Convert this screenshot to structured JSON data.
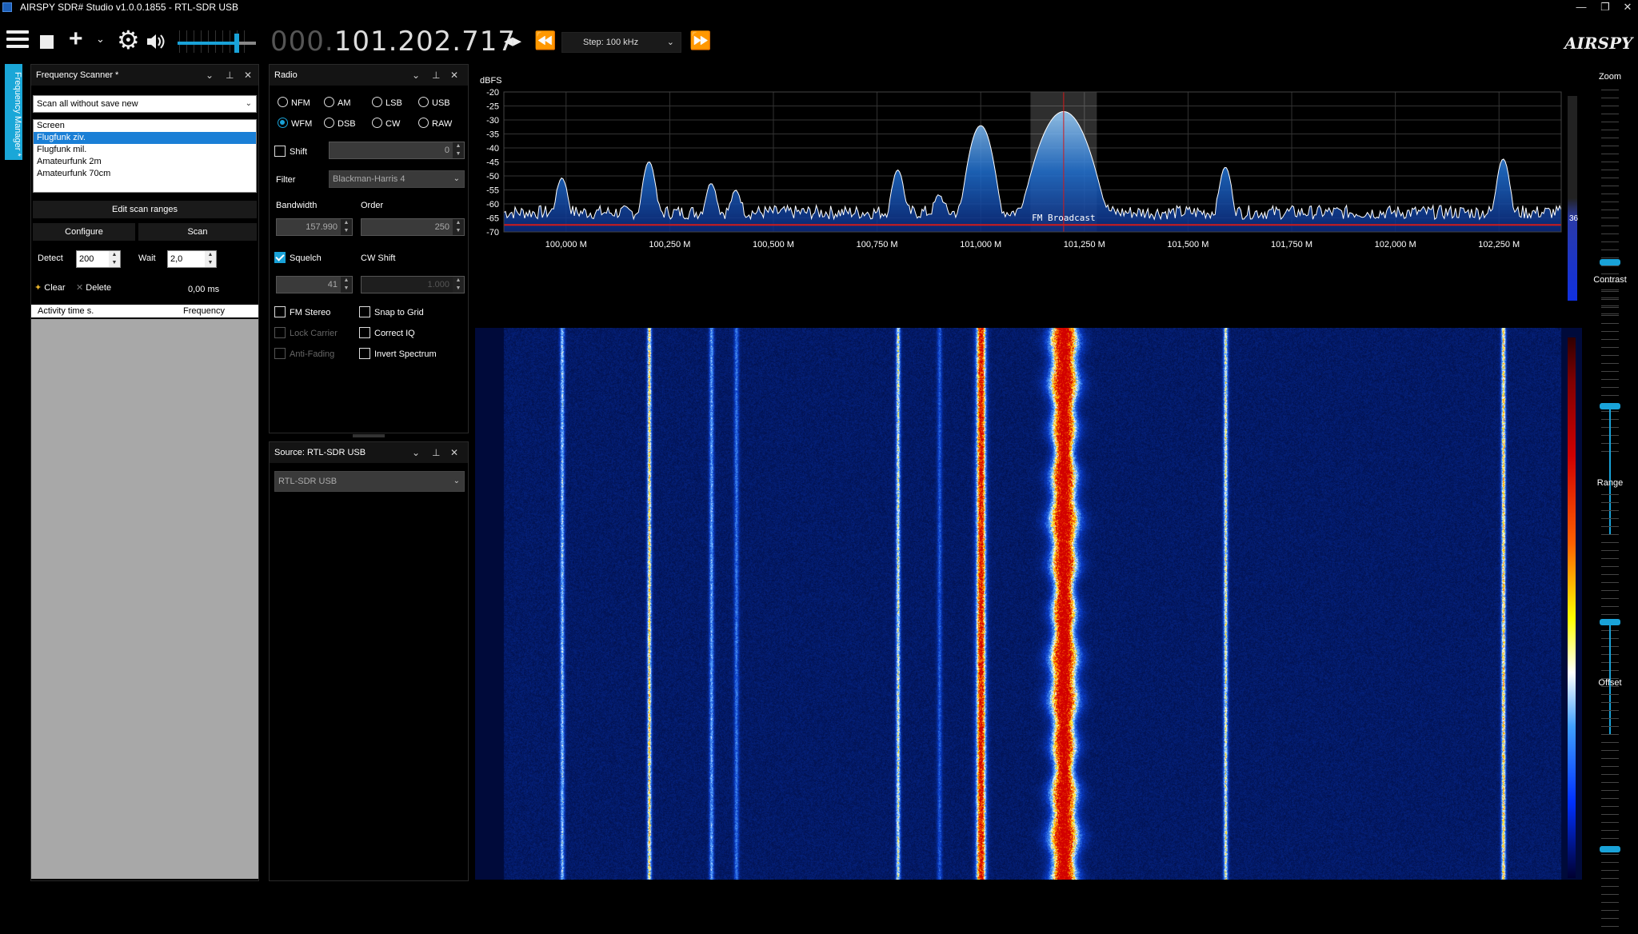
{
  "window": {
    "title": "AIRSPY SDR# Studio v1.0.0.1855 - RTL-SDR USB",
    "buttons": [
      "—",
      "❐",
      "✕"
    ]
  },
  "toolbar": {
    "frequency_dim": "000.",
    "frequency_lit": "101.202.717",
    "step_label": "Step: 100 kHz",
    "brand": "AIRSPY",
    "volume_level": 0.75
  },
  "sidetab": {
    "label": "Frequency Manager *"
  },
  "scanner": {
    "title": "Frequency Scanner *",
    "mode": "Scan all without save new",
    "ranges": [
      "Screen",
      "Flugfunk ziv.",
      "Flugfunk mil.",
      "Amateurfunk 2m",
      "Amateurfunk 70cm"
    ],
    "selected_index": 1,
    "edit_ranges": "Edit scan ranges",
    "configure": "Configure",
    "scan": "Scan",
    "detect_label": "Detect",
    "detect_value": "200",
    "wait_label": "Wait",
    "wait_value": "2,0",
    "clear": "Clear",
    "delete": "Delete",
    "time": "0,00 ms",
    "col_activity": "Activity time s.",
    "col_frequency": "Frequency"
  },
  "radio": {
    "title": "Radio",
    "modes": [
      "NFM",
      "AM",
      "LSB",
      "USB",
      "WFM",
      "DSB",
      "CW",
      "RAW"
    ],
    "selected_mode": "WFM",
    "shift_label": "Shift",
    "shift_value": "0",
    "filter_label": "Filter",
    "filter_value": "Blackman-Harris 4",
    "bandwidth_label": "Bandwidth",
    "bandwidth_value": "157.990",
    "order_label": "Order",
    "order_value": "250",
    "squelch_label": "Squelch",
    "squelch_value": "41",
    "cwshift_label": "CW Shift",
    "cwshift_value": "1.000",
    "fm_stereo": "FM Stereo",
    "snap_to_grid": "Snap to Grid",
    "lock_carrier": "Lock Carrier",
    "correct_iq": "Correct IQ",
    "anti_fading": "Anti-Fading",
    "invert_spectrum": "Invert Spectrum"
  },
  "source": {
    "title": "Source: RTL-SDR USB",
    "device": "RTL-SDR USB"
  },
  "rightbar": {
    "zoom": "Zoom",
    "contrast": "Contrast",
    "range": "Range",
    "offset": "Offset",
    "range_value": "36"
  },
  "colors": {
    "accent": "#19a2d8",
    "trace": "#ffffff",
    "fill": "#1f6fd0",
    "grid": "#333333",
    "squelch": "#d11a1a"
  },
  "chart_data": {
    "type": "line",
    "ylabel": "dBFS",
    "ylim": [
      -70,
      -20
    ],
    "yticks": [
      -20,
      -25,
      -30,
      -35,
      -40,
      -45,
      -50,
      -55,
      -60,
      -65,
      -70
    ],
    "xlim": [
      99.85,
      102.4
    ],
    "xticks": [
      "100,000 M",
      "100,250 M",
      "100,500 M",
      "100,750 M",
      "101,000 M",
      "101,250 M",
      "101,500 M",
      "101,750 M",
      "102,000 M",
      "102,250 M"
    ],
    "xtick_values": [
      100.0,
      100.25,
      100.5,
      100.75,
      101.0,
      101.25,
      101.5,
      101.75,
      102.0,
      102.25
    ],
    "noise_floor": -63,
    "peaks": [
      {
        "f": 99.99,
        "level": -51
      },
      {
        "f": 100.2,
        "level": -45
      },
      {
        "f": 100.35,
        "level": -53
      },
      {
        "f": 100.41,
        "level": -56
      },
      {
        "f": 100.8,
        "level": -48
      },
      {
        "f": 100.9,
        "level": -58
      },
      {
        "f": 101.0,
        "level": -32
      },
      {
        "f": 101.2,
        "level": -27
      },
      {
        "f": 101.59,
        "level": -47
      },
      {
        "f": 102.26,
        "level": -44
      }
    ],
    "annotation": "FM Broadcast",
    "tuned_frequency": 101.2,
    "filter_band": [
      101.12,
      101.28
    ]
  }
}
